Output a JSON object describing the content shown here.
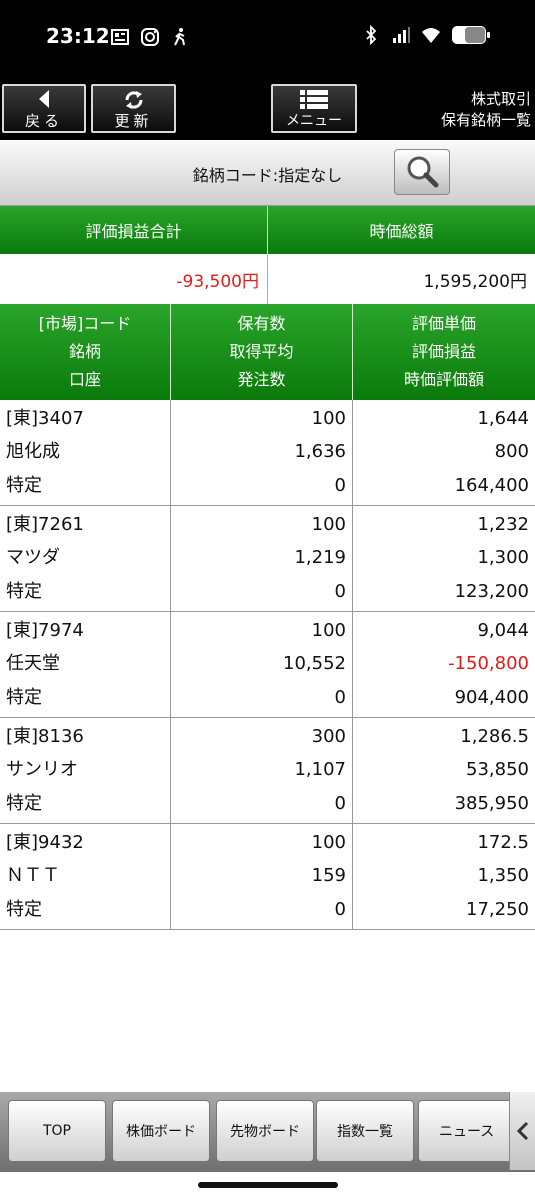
{
  "status": {
    "time": "23:12",
    "icons_left": [
      "news-icon",
      "instagram-icon",
      "walking-icon"
    ],
    "icons_right": [
      "bluetooth-icon",
      "signal-icon",
      "wifi-icon",
      "battery-icon"
    ]
  },
  "toolbar": {
    "back_label": "戻る",
    "refresh_label": "更新",
    "menu_label": "メニュー",
    "title_line1": "株式取引",
    "title_line2": "保有銘柄一覧"
  },
  "search": {
    "label": "銘柄コード:指定なし"
  },
  "summary": {
    "pl_header": "評価損益合計",
    "value_header": "時価総額",
    "pl_value": "-93,500円",
    "market_value": "1,595,200円"
  },
  "table": {
    "headers": {
      "col1": [
        "[市場]コード",
        "銘柄",
        "口座"
      ],
      "col2": [
        "保有数",
        "取得平均",
        "発注数"
      ],
      "col3": [
        "評価単価",
        "評価損益",
        "時価評価額"
      ]
    },
    "rows": [
      {
        "code": "[東]3407",
        "name": "旭化成",
        "account": "特定",
        "qty": "100",
        "avg": "1,636",
        "orders": "0",
        "price": "1,644",
        "pl": "800",
        "pl_negative": false,
        "value": "164,400"
      },
      {
        "code": "[東]7261",
        "name": "マツダ",
        "account": "特定",
        "qty": "100",
        "avg": "1,219",
        "orders": "0",
        "price": "1,232",
        "pl": "1,300",
        "pl_negative": false,
        "value": "123,200"
      },
      {
        "code": "[東]7974",
        "name": "任天堂",
        "account": "特定",
        "qty": "100",
        "avg": "10,552",
        "orders": "0",
        "price": "9,044",
        "pl": "-150,800",
        "pl_negative": true,
        "value": "904,400"
      },
      {
        "code": "[東]8136",
        "name": "サンリオ",
        "account": "特定",
        "qty": "300",
        "avg": "1,107",
        "orders": "0",
        "price": "1,286.5",
        "pl": "53,850",
        "pl_negative": false,
        "value": "385,950"
      },
      {
        "code": "[東]9432",
        "name": "ＮＴＴ",
        "account": "特定",
        "qty": "100",
        "avg": "159",
        "orders": "0",
        "price": "172.5",
        "pl": "1,350",
        "pl_negative": false,
        "value": "17,250"
      }
    ]
  },
  "bottom_tabs": [
    "TOP",
    "株価ボード",
    "先物ボード",
    "指数一覧",
    "ニュース"
  ],
  "colors": {
    "header_green": "#0a7a0a",
    "negative_red": "#e21b1b"
  }
}
